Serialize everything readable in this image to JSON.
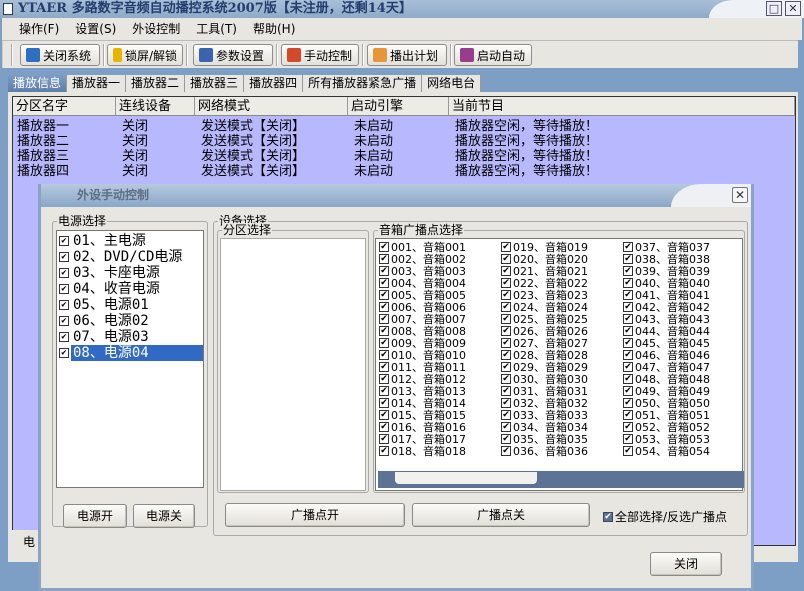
{
  "app": {
    "title": "YTAER 多路数字音频自动播控系统2007版【未注册，还剩14天】",
    "restore_label": "□",
    "close_label": "✕"
  },
  "menu": [
    {
      "label": "操作(F)"
    },
    {
      "label": "设置(S)"
    },
    {
      "label": "外设控制"
    },
    {
      "label": "工具(T)"
    },
    {
      "label": "帮助(H)"
    }
  ],
  "toolbar": [
    {
      "label": "关闭系统",
      "icon": "exit-icon",
      "color": "#2d6fc0"
    },
    {
      "label": "锁屏/解锁",
      "icon": "lock-icon",
      "color": "#e8b400"
    },
    {
      "label": "参数设置",
      "icon": "settings-icon",
      "color": "#3a64b0"
    },
    {
      "label": "手动控制",
      "icon": "palette-icon",
      "color": "#d24a2a"
    },
    {
      "label": "播出计划",
      "icon": "schedule-icon",
      "color": "#e6953a"
    },
    {
      "label": "启动自动",
      "icon": "auto-start-icon",
      "color": "#9a3c8c"
    }
  ],
  "tabs": [
    {
      "label": "播放信息",
      "active": true
    },
    {
      "label": "播放器一"
    },
    {
      "label": "播放器二"
    },
    {
      "label": "播放器三"
    },
    {
      "label": "播放器四"
    },
    {
      "label": "所有播放器紧急广播"
    },
    {
      "label": "网络电台"
    }
  ],
  "grid": {
    "columns": [
      "分区名字",
      "连线设备",
      "网络模式",
      "启动引擎",
      "当前节目"
    ],
    "rows": [
      [
        "播放器一",
        "关闭",
        "发送模式【关闭】",
        "未启动",
        "播放器空闲，等待播放！"
      ],
      [
        "播放器二",
        "关闭",
        "发送模式【关闭】",
        "未启动",
        "播放器空闲，等待播放！"
      ],
      [
        "播放器三",
        "关闭",
        "发送模式【关闭】",
        "未启动",
        "播放器空闲，等待播放！"
      ],
      [
        "播放器四",
        "关闭",
        "发送模式【关闭】",
        "未启动",
        "播放器空闲，等待播放！"
      ]
    ]
  },
  "status_left": "电源",
  "dialog": {
    "title": "外设手动控制",
    "close_label": "✕",
    "power_group": "电源选择",
    "power_items": [
      {
        "label": "01、主电源",
        "checked": true
      },
      {
        "label": "02、DVD/CD电源",
        "checked": true
      },
      {
        "label": "03、卡座电源",
        "checked": true
      },
      {
        "label": "04、收音电源",
        "checked": true
      },
      {
        "label": "05、电源01",
        "checked": true
      },
      {
        "label": "06、电源02",
        "checked": true
      },
      {
        "label": "07、电源03",
        "checked": true
      },
      {
        "label": "08、电源04",
        "checked": true,
        "selected": true
      }
    ],
    "power_on": "电源开",
    "power_off": "电源关",
    "device_group": "设备选择",
    "zone_group": "分区选择",
    "speaker_group": "音箱广播点选择",
    "broadcast_on": "广播点开",
    "broadcast_off": "广播点关",
    "select_all_label": "全部选择/反选广播点",
    "select_all_checked": true,
    "close_button": "关闭"
  }
}
